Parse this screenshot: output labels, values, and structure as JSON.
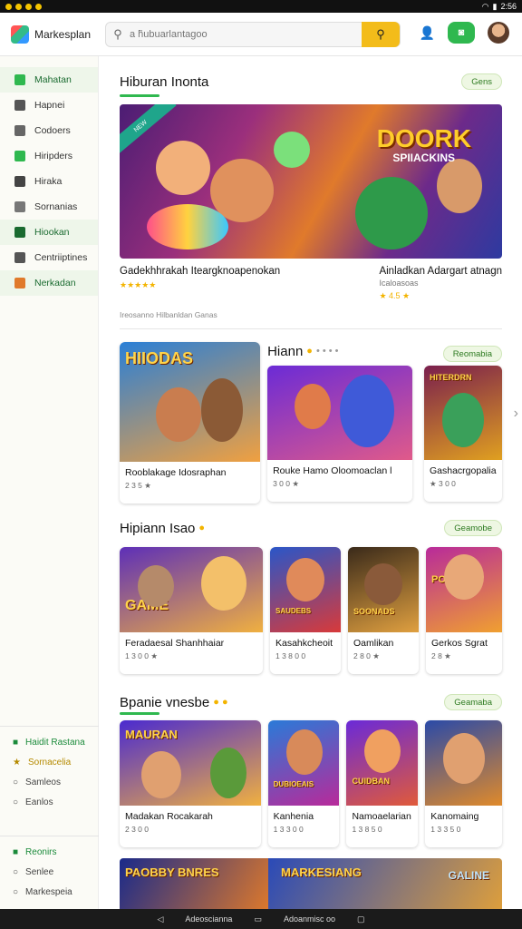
{
  "status": {
    "time": "2:56"
  },
  "app": {
    "name": "Markesplan"
  },
  "search": {
    "placeholder": "a h̃ubuarlantagoo"
  },
  "sidebar": {
    "items": [
      {
        "label": "Mahatan",
        "color": "#2fb84f",
        "active": true
      },
      {
        "label": "Hapnei",
        "color": "#555"
      },
      {
        "label": "Codoers",
        "color": "#666"
      },
      {
        "label": "Hiripders",
        "color": "#2fb84f"
      },
      {
        "label": "Hiraka",
        "color": "#444"
      },
      {
        "label": "Sornanias",
        "color": "#777"
      },
      {
        "label": "Hiookan",
        "color": "#1a6b30",
        "active": true
      },
      {
        "label": "Centriiptines",
        "color": "#555"
      },
      {
        "label": "Nerkadan",
        "color": "#e07a2b",
        "active": true
      }
    ],
    "lower": [
      {
        "label": "Haidit Rastana",
        "style": "hl"
      },
      {
        "label": "Sornacelia",
        "style": "gold"
      },
      {
        "label": "Samleos",
        "style": ""
      },
      {
        "label": "Eanlos",
        "style": ""
      }
    ],
    "bottom": [
      {
        "label": "Reonirs",
        "style": "hl"
      },
      {
        "label": "Senlee",
        "style": ""
      },
      {
        "label": "Markespeia",
        "style": ""
      }
    ]
  },
  "featured": {
    "title": "Hiburan Inonta",
    "pill": "Gens",
    "hero_title": "DOORK",
    "hero_sub": "SPIIACKINS",
    "left_name": "Gadekhhrakah Iteargknoapenokan",
    "right_name": "Ainladkan Adargart atnagn",
    "right_sub": "Icaloasoas",
    "left_rating": "★★★★★",
    "right_rating": "★ 4.5 ★",
    "caption": "Ireosanno Hilbanldan Ganas"
  },
  "section2": {
    "title": "Hiann",
    "pill": "Reomabia",
    "tiles": [
      {
        "label": "HIIODAS",
        "name": "Rooblakage Idosraphan",
        "sub": "2 3 5 ★"
      },
      {
        "label": "",
        "name": "Rouke Hamo Oloomoaclan l",
        "sub": "3 0 0 ★"
      },
      {
        "label": "HITERDRN",
        "name": "Gashacrgopalia",
        "sub": "★ 3 0 0"
      }
    ]
  },
  "section3": {
    "title": "Hipiann Isao",
    "pill": "Geamobe",
    "tiles": [
      {
        "label": "GAME",
        "name": "Feradaesal Shanhhaiar",
        "sub": "1 3 0 0 ★"
      },
      {
        "label": "SAUDEBS",
        "name": "Kasahkcheoit",
        "sub": "1 3 8 0 0"
      },
      {
        "label": "SOONADS",
        "name": "Oamlikan",
        "sub": "2 8 0 ★"
      },
      {
        "label": "POLEENS",
        "name": "Gerkos Sgrat",
        "sub": "2 8 ★"
      }
    ]
  },
  "section4": {
    "title": "Bpanie vnesbe",
    "pill": "Geamaba",
    "tiles": [
      {
        "label": "MAURAN",
        "name": "Madakan Rocakarah",
        "sub": "2 3 0 0"
      },
      {
        "label": "DUBIOEAIS",
        "name": "Kanhenia",
        "sub": "1 3 3 0 0"
      },
      {
        "label": "CUIDBAN",
        "name": "Namoaelarian",
        "sub": "1 3 8 5 0"
      },
      {
        "label": "",
        "name": "Kanomaing",
        "sub": "1 3 3 5 0"
      }
    ]
  },
  "banner": {
    "left": "PAOBBY BNRES",
    "right": "MARKESIANG",
    "tag": "GALINE"
  },
  "navbar": {
    "left": "Adeoscianna",
    "right": "Adoanmisc oo"
  }
}
